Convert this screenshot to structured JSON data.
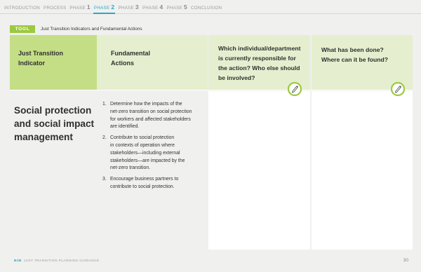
{
  "nav": {
    "items": [
      {
        "label": "INTRODUCTION",
        "num": ""
      },
      {
        "label": "PROCESS",
        "num": ""
      },
      {
        "label": "PHASE",
        "num": "1"
      },
      {
        "label": "PHASE",
        "num": "2",
        "active": true
      },
      {
        "label": "PHASE",
        "num": "3"
      },
      {
        "label": "PHASE",
        "num": "4"
      },
      {
        "label": "PHASE",
        "num": "5"
      },
      {
        "label": "CONCLUSION",
        "num": ""
      }
    ]
  },
  "tool": {
    "badge": "TOOL",
    "title": "Just Transition Indicators and Fundamental Actions"
  },
  "table": {
    "headers": [
      [
        "Just Transition",
        "Indicator"
      ],
      [
        "Fundamental",
        "Actions"
      ],
      [
        "Which individual/department",
        "is currently responsible for",
        "the action? Who else should",
        "be involved?"
      ],
      [
        "What has been done?",
        "Where can it be found?"
      ]
    ],
    "indicator": [
      "Social protection",
      "and social impact",
      "management"
    ],
    "actions": [
      {
        "num": "1.",
        "lines": [
          "Determine how the impacts of the",
          "net-zero transition on social protection",
          "for workers and affected stakeholders",
          "are identified."
        ]
      },
      {
        "num": "2.",
        "lines": [
          "Contribute to social protection",
          "in contexts of operation where",
          "stakeholders—including external",
          "stakeholders—are impacted by the",
          "net-zero transition."
        ]
      },
      {
        "num": "3.",
        "lines": [
          "Encourage business partners to",
          "contribute to social protection."
        ]
      }
    ]
  },
  "footer": {
    "brand": "B2B",
    "text": "JUST TRANSITION PLANNING GUIDANCE",
    "page": "30"
  },
  "colors": {
    "accent": "#29a8c9",
    "green": "#9dc940",
    "header_dark": "#c4de86",
    "header_light": "#e5efcf"
  },
  "icons": [
    "pencil-edit-icon"
  ]
}
